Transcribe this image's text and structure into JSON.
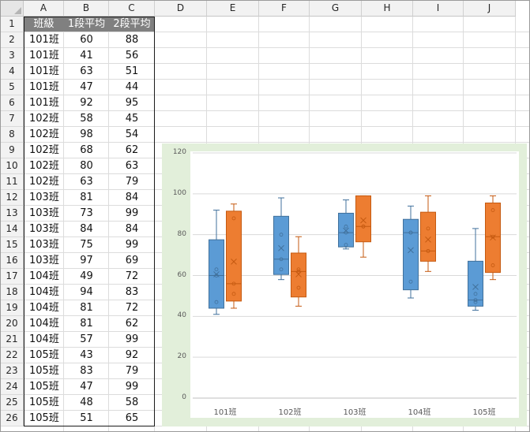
{
  "spreadsheet": {
    "columns": [
      "A",
      "B",
      "C",
      "D",
      "E",
      "F",
      "G",
      "H",
      "I",
      "J"
    ],
    "rows": [
      "1",
      "2",
      "3",
      "4",
      "5",
      "6",
      "7",
      "8",
      "9",
      "10",
      "11",
      "12",
      "13",
      "14",
      "15",
      "16",
      "17",
      "18",
      "19",
      "20",
      "21",
      "22",
      "23",
      "24",
      "25",
      "26"
    ],
    "headers": [
      "班級",
      "1段平均",
      "2段平均"
    ],
    "data": [
      [
        "101班",
        "60",
        "88"
      ],
      [
        "101班",
        "41",
        "56"
      ],
      [
        "101班",
        "63",
        "51"
      ],
      [
        "101班",
        "47",
        "44"
      ],
      [
        "101班",
        "92",
        "95"
      ],
      [
        "102班",
        "58",
        "45"
      ],
      [
        "102班",
        "98",
        "54"
      ],
      [
        "102班",
        "68",
        "62"
      ],
      [
        "102班",
        "80",
        "63"
      ],
      [
        "102班",
        "63",
        "79"
      ],
      [
        "103班",
        "81",
        "84"
      ],
      [
        "103班",
        "73",
        "99"
      ],
      [
        "103班",
        "84",
        "84"
      ],
      [
        "103班",
        "75",
        "99"
      ],
      [
        "103班",
        "97",
        "69"
      ],
      [
        "104班",
        "49",
        "72"
      ],
      [
        "104班",
        "94",
        "83"
      ],
      [
        "104班",
        "81",
        "72"
      ],
      [
        "104班",
        "81",
        "62"
      ],
      [
        "104班",
        "57",
        "99"
      ],
      [
        "105班",
        "43",
        "92"
      ],
      [
        "105班",
        "83",
        "79"
      ],
      [
        "105班",
        "47",
        "99"
      ],
      [
        "105班",
        "48",
        "58"
      ],
      [
        "105班",
        "51",
        "65"
      ]
    ]
  },
  "chart_data": {
    "type": "boxplot",
    "categories": [
      "101班",
      "102班",
      "103班",
      "104班",
      "105班"
    ],
    "ylim": [
      0,
      120
    ],
    "yticks": [
      "0",
      "20",
      "40",
      "60",
      "80",
      "100",
      "120"
    ],
    "grid": true,
    "series": [
      {
        "color": "#5b9bd5",
        "stroke": "#41719c",
        "boxes": [
          {
            "min": 41,
            "q1": 44,
            "median": 60,
            "q3": 77.5,
            "max": 92,
            "mean": 60.6,
            "points": [
              60,
              41,
              63,
              47,
              92
            ]
          },
          {
            "min": 58,
            "q1": 60.5,
            "median": 68,
            "q3": 89,
            "max": 98,
            "mean": 73.4,
            "points": [
              58,
              98,
              68,
              80,
              63
            ]
          },
          {
            "min": 73,
            "q1": 74,
            "median": 81,
            "q3": 90.5,
            "max": 97,
            "mean": 82,
            "points": [
              81,
              73,
              84,
              75,
              97
            ]
          },
          {
            "min": 49,
            "q1": 53,
            "median": 81,
            "q3": 87.5,
            "max": 94,
            "mean": 72.4,
            "points": [
              49,
              94,
              81,
              81,
              57
            ]
          },
          {
            "min": 43,
            "q1": 45,
            "median": 48,
            "q3": 67,
            "max": 83,
            "mean": 54.4,
            "points": [
              43,
              83,
              47,
              48,
              51
            ]
          }
        ]
      },
      {
        "color": "#ed7d31",
        "stroke": "#c55a11",
        "boxes": [
          {
            "min": 44,
            "q1": 47.5,
            "median": 56,
            "q3": 91.5,
            "max": 95,
            "mean": 66.8,
            "points": [
              88,
              56,
              51,
              44,
              95
            ]
          },
          {
            "min": 45,
            "q1": 49.5,
            "median": 62,
            "q3": 71,
            "max": 79,
            "mean": 60.6,
            "points": [
              45,
              54,
              62,
              63,
              79
            ]
          },
          {
            "min": 69,
            "q1": 76.5,
            "median": 84,
            "q3": 99,
            "max": 99,
            "mean": 87,
            "points": [
              84,
              99,
              84,
              99,
              69
            ]
          },
          {
            "min": 62,
            "q1": 67,
            "median": 72,
            "q3": 91,
            "max": 99,
            "mean": 77.6,
            "points": [
              72,
              83,
              72,
              62,
              99
            ]
          },
          {
            "min": 58,
            "q1": 61.5,
            "median": 79,
            "q3": 95.5,
            "max": 99,
            "mean": 78.6,
            "points": [
              92,
              79,
              99,
              58,
              65
            ]
          }
        ]
      }
    ]
  }
}
